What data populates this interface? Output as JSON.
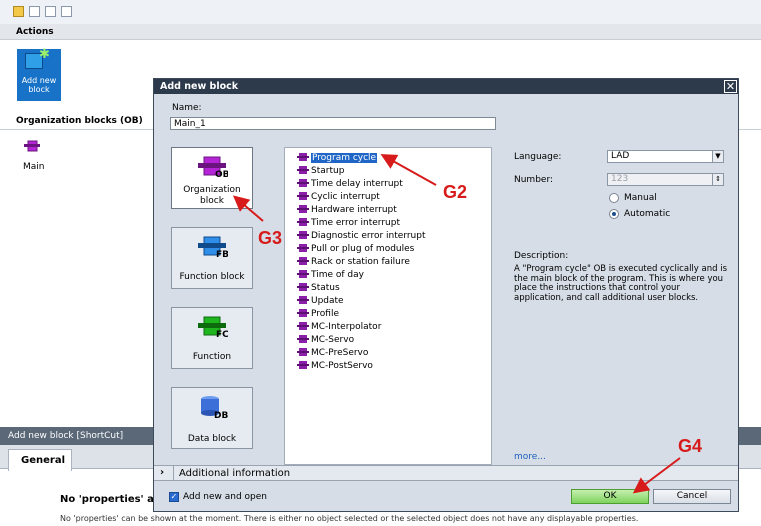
{
  "background": {
    "actions_header": "Actions",
    "add_new_block_tile": "Add new block",
    "organization_blocks_header": "Organization blocks (OB)",
    "main_item": "Main",
    "properties_header": "Add new block [ShortCut]",
    "general_tab": "General",
    "no_properties_title": "No 'properties' a",
    "no_properties_text": "No 'properties' can be shown at the moment. There is either no object selected or the selected object does not have any displayable properties."
  },
  "dialog": {
    "title": "Add new block",
    "close_icon": "close-icon",
    "name_label": "Name:",
    "name_value": "Main_1",
    "block_types": [
      {
        "label": "Organization block",
        "badge": "OB",
        "color": "#b325d6"
      },
      {
        "label": "Function block",
        "badge": "FB",
        "color": "#2e8ee8"
      },
      {
        "label": "Function",
        "badge": "FC",
        "color": "#1fb51f"
      },
      {
        "label": "Data block",
        "badge": "DB",
        "color": "#3c6fd8"
      }
    ],
    "ob_list": [
      "Program cycle",
      "Startup",
      "Time delay interrupt",
      "Cyclic interrupt",
      "Hardware interrupt",
      "Time error interrupt",
      "Diagnostic error interrupt",
      "Pull or plug of modules",
      "Rack or station failure",
      "Time of day",
      "Status",
      "Update",
      "Profile",
      "MC-Interpolator",
      "MC-Servo",
      "MC-PreServo",
      "MC-PostServo"
    ],
    "language_label": "Language:",
    "language_value": "LAD",
    "number_label": "Number:",
    "number_value": "123",
    "manual_label": "Manual",
    "automatic_label": "Automatic",
    "description_label": "Description:",
    "description_text": "A \"Program cycle\" OB is executed cyclically and is the main block of the program. This is where you place the instructions that control your application, and call additional user blocks.",
    "more_link": "more...",
    "additional_info": "Additional information",
    "add_new_and_open": "Add new and open",
    "ok_label": "OK",
    "cancel_label": "Cancel"
  },
  "annotations": {
    "g2": "G2",
    "g3": "G3",
    "g4": "G4",
    "color": "#d71b1b"
  }
}
